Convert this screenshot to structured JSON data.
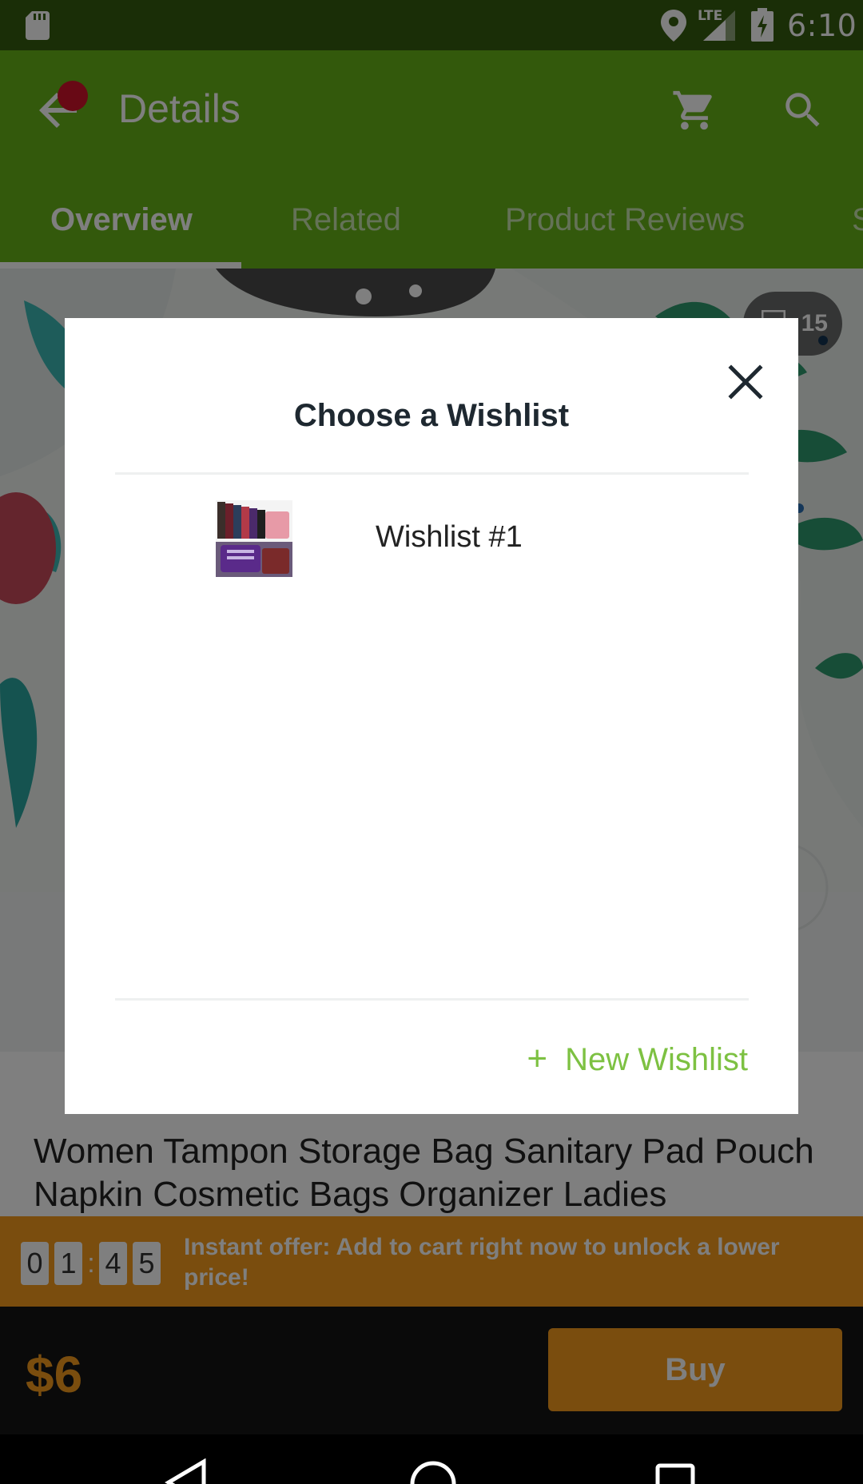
{
  "status_bar": {
    "network": "LTE",
    "time": "6:10"
  },
  "toolbar": {
    "title": "Details"
  },
  "tabs": [
    {
      "label": "Overview",
      "active": true
    },
    {
      "label": "Related",
      "active": false
    },
    {
      "label": "Product Reviews",
      "active": false
    },
    {
      "label": "S",
      "active": false
    }
  ],
  "product": {
    "image_count": "15",
    "title": "Women Tampon Storage Bag Sanitary Pad Pouch Napkin Cosmetic Bags Organizer Ladies"
  },
  "offer": {
    "timer_digits": [
      "0",
      "1",
      "4",
      "5"
    ],
    "timer_separator": ":",
    "text": "Instant offer: Add to cart right now to unlock a lower price!"
  },
  "purchase": {
    "price": "$6",
    "buy_label": "Buy"
  },
  "dialog": {
    "title": "Choose a Wishlist",
    "wishlists": [
      {
        "name": "Wishlist #1"
      }
    ],
    "new_wishlist_label": "New Wishlist",
    "new_wishlist_icon": "+"
  },
  "colors": {
    "brand_green": "#66b219",
    "status_green": "#345c0e",
    "accent_orange": "#f49b1c",
    "link_green": "#7dc142"
  },
  "icons": [
    "sd-card-icon",
    "location-icon",
    "signal-icon",
    "battery-charging-icon",
    "back-arrow-icon",
    "cart-icon",
    "search-icon",
    "image-gallery-icon",
    "close-icon",
    "plus-icon",
    "nav-back-icon",
    "nav-home-icon",
    "nav-recents-icon"
  ]
}
